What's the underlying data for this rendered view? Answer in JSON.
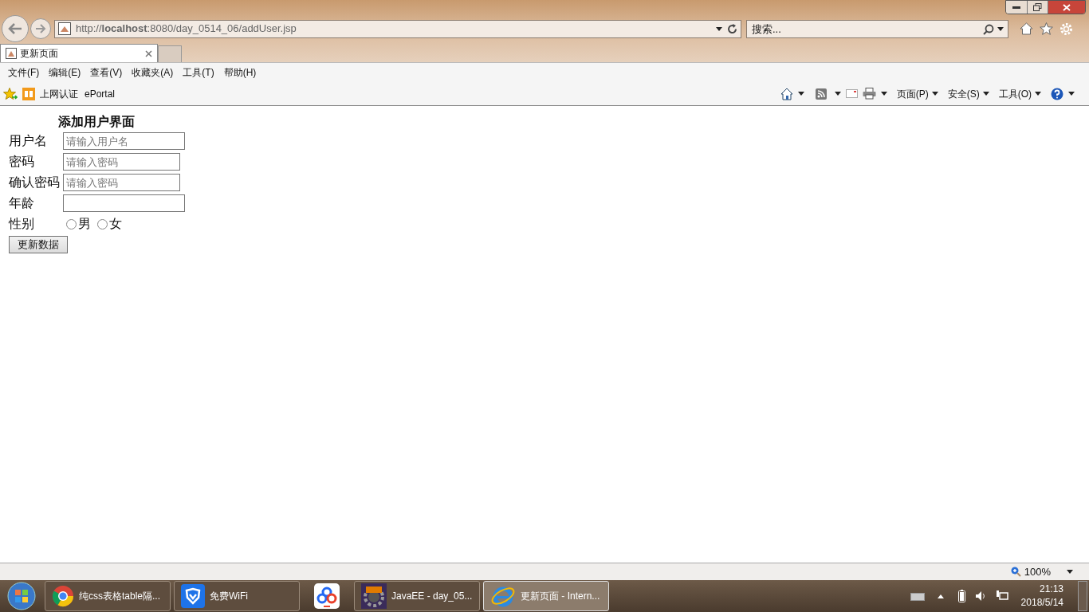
{
  "address_bar": {
    "url": "http://**localhost**:8080/day_0514_06/addUser.jsp"
  },
  "search": {
    "placeholder": "搜索..."
  },
  "tabs": [
    {
      "label": "更新页面",
      "selected": true
    }
  ],
  "menu": [
    "文件(F)",
    "编辑(E)",
    "查看(V)",
    "收藏夹(A)",
    "工具(T)",
    "帮助(H)"
  ],
  "favorites": [
    "上网认证",
    "ePortal"
  ],
  "command_bar": [
    "页面(P)",
    "安全(S)",
    "工具(O)"
  ],
  "page": {
    "heading": "添加用户界面",
    "fields": [
      {
        "kind": "text",
        "label": "用户名",
        "placeholder": "请输入用户名"
      },
      {
        "kind": "text",
        "label": "密码",
        "placeholder": "请输入密码"
      },
      {
        "kind": "text",
        "label": "确认密码",
        "placeholder": "请输入密码"
      },
      {
        "kind": "text",
        "label": "年龄"
      },
      {
        "kind": "radio",
        "label": "性别",
        "options": [
          {
            "label": "男",
            "selected": false
          },
          {
            "label": "女",
            "selected": false
          }
        ]
      }
    ],
    "submit": "更新数据"
  },
  "status_bar": {
    "zoom": "100%"
  },
  "taskbar": {
    "items": [
      {
        "label": "纯css表格table隔...",
        "selected": false
      },
      {
        "label": "免费WiFi",
        "selected": false
      },
      {
        "selected": false
      },
      {
        "label": "JavaEE - day_05...",
        "selected": false
      },
      {
        "label": "更新页面 - Intern...",
        "selected": true
      }
    ],
    "time": "21:13",
    "date": "2018/5/14"
  }
}
